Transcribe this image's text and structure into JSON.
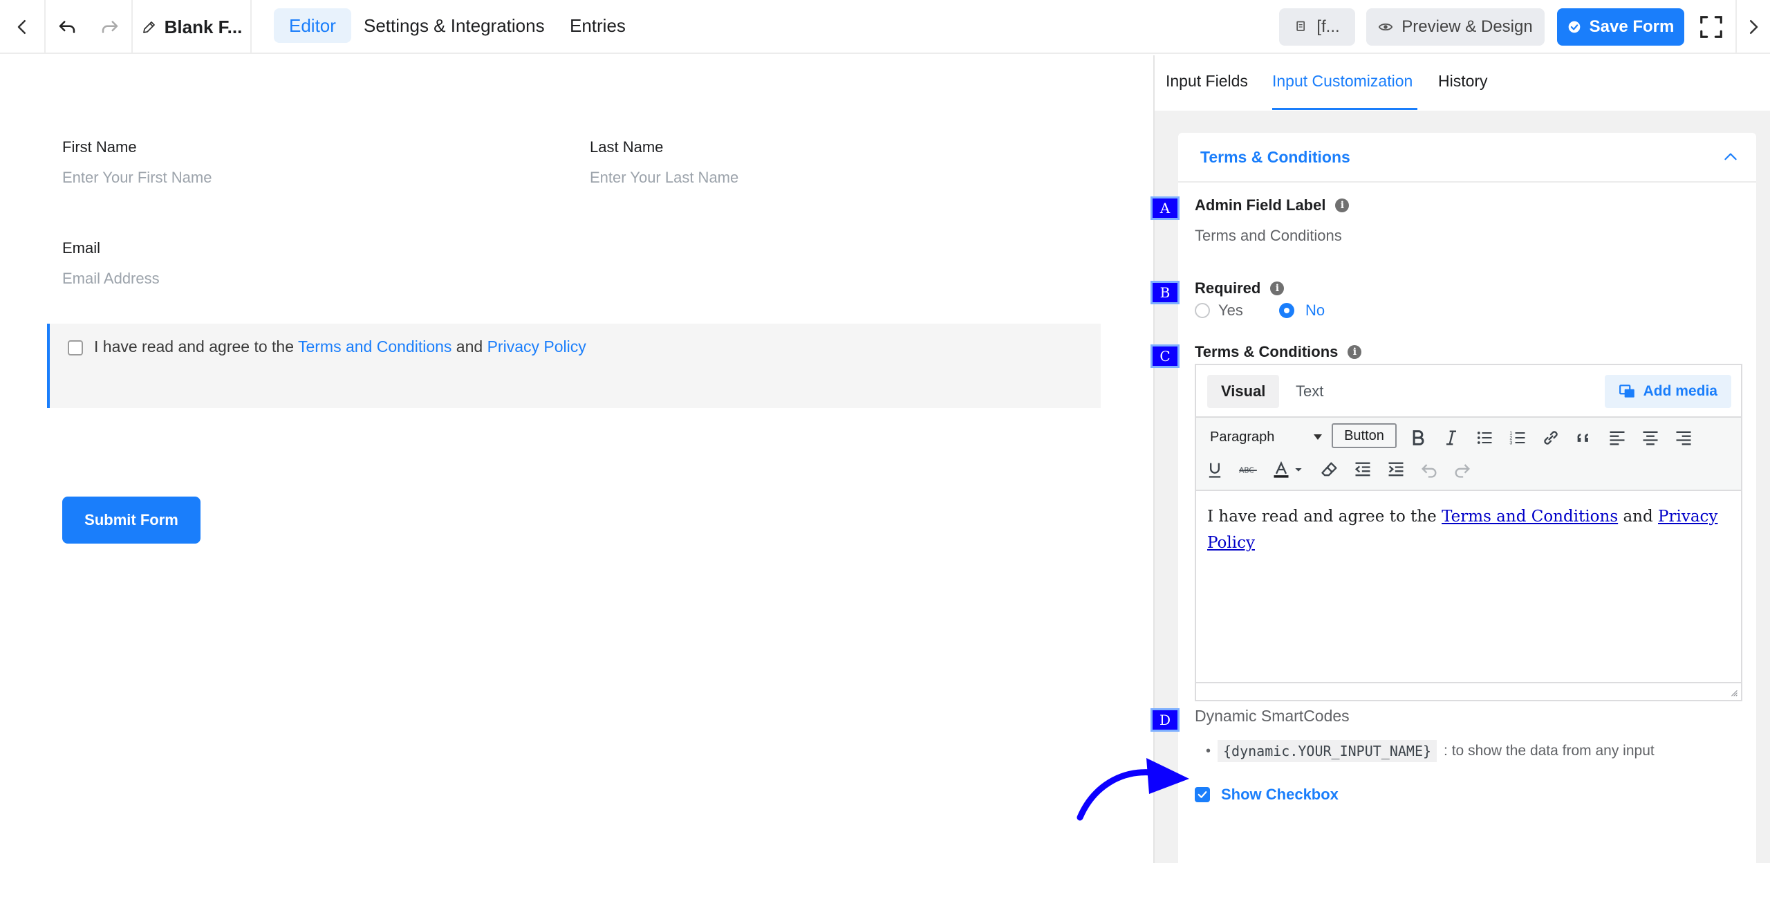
{
  "topbar": {
    "form_name": "Blank F...",
    "tabs": [
      "Editor",
      "Settings & Integrations",
      "Entries"
    ],
    "shortcode_label": "[f...",
    "preview_label": "Preview & Design",
    "save_label": "Save Form"
  },
  "form": {
    "first_name": {
      "label": "First Name",
      "placeholder": "Enter Your First Name"
    },
    "last_name": {
      "label": "Last Name",
      "placeholder": "Enter Your Last Name"
    },
    "email": {
      "label": "Email",
      "placeholder": "Email Address"
    },
    "terms": {
      "prefix": "I have read and agree to the ",
      "link1": "Terms and Conditions",
      "mid": " and ",
      "link2": "Privacy Policy"
    },
    "submit_label": "Submit Form"
  },
  "panel": {
    "tabs": [
      "Input Fields",
      "Input Customization",
      "History"
    ],
    "section_title": "Terms & Conditions",
    "admin_label": {
      "label": "Admin Field Label",
      "value": "Terms and Conditions"
    },
    "required": {
      "label": "Required",
      "options": [
        "Yes",
        "No"
      ],
      "selected": "No"
    },
    "terms_editor": {
      "label": "Terms & Conditions",
      "tabs": [
        "Visual",
        "Text"
      ],
      "add_media": "Add media",
      "format_select": "Paragraph",
      "button_tool": "Button",
      "content_prefix": "I have read and agree to the ",
      "content_link1": "Terms and Conditions",
      "content_mid": " and ",
      "content_link2a": "Privacy",
      "content_link2b": "Policy"
    },
    "smartcodes": {
      "title": "Dynamic SmartCodes",
      "code": "{dynamic.YOUR_INPUT_NAME}",
      "desc": ": to show the data from any input"
    },
    "show_checkbox": {
      "label": "Show Checkbox",
      "checked": true
    }
  },
  "annotations": [
    "A",
    "B",
    "C",
    "D"
  ],
  "colors": {
    "accent": "#1a7efb",
    "annotation": "#0c00ff"
  }
}
